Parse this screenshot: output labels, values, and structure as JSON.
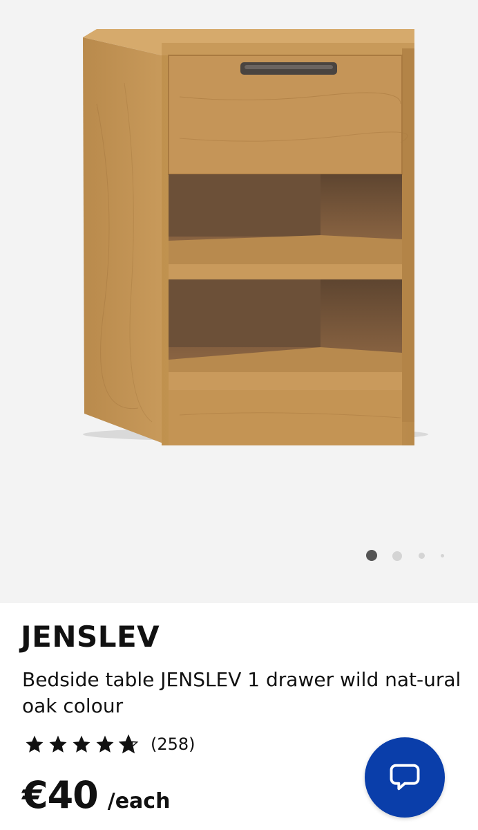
{
  "gallery": {
    "image_alt": "Bedside table JENSLEV 1 drawer wild natural oak colour",
    "current_slide": 1,
    "slide_count": 4
  },
  "product": {
    "brand": "JENSLEV",
    "description": "Bedside table JENSLEV 1 drawer wild nat-ural oak colour",
    "rating_stars": 4.7,
    "review_count": "(258)",
    "price": "€40",
    "unit": "/each"
  },
  "chat": {
    "icon": "chat-bubble-icon"
  },
  "colors": {
    "chat_button": "#0a3eaa",
    "gallery_bg": "#f3f3f3",
    "dot_active": "#555555",
    "dot_inactive": "#d4d4d4"
  }
}
